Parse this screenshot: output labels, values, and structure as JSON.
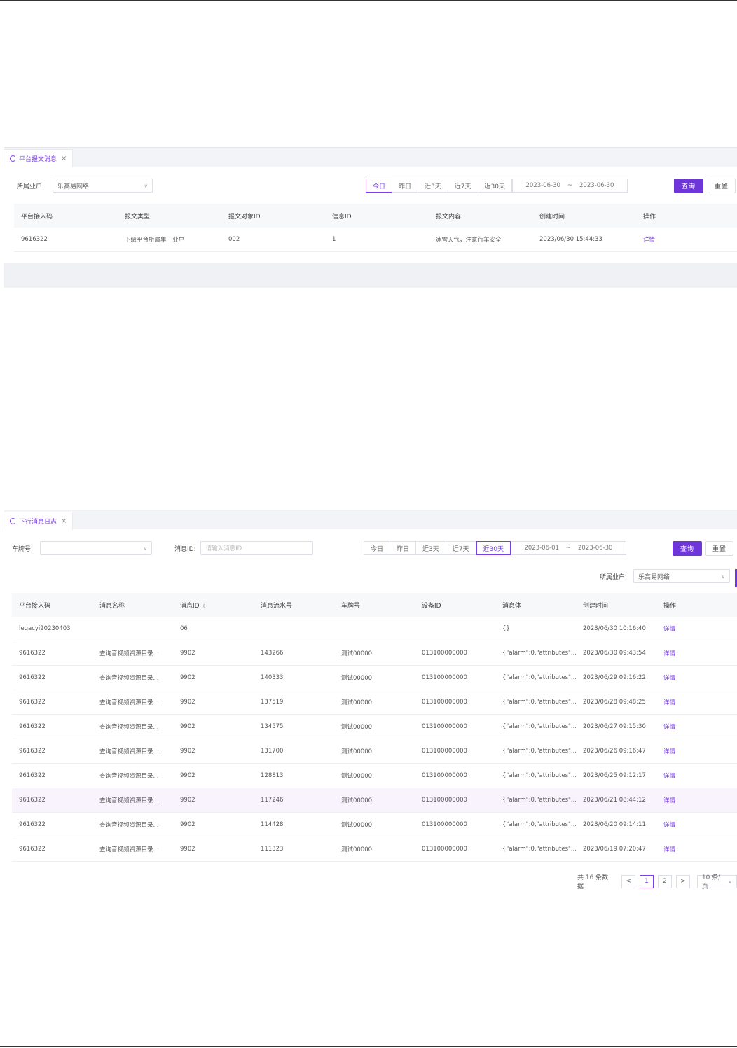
{
  "panel1": {
    "tab_label": "平台报文消息",
    "filter_label": "所属业户:",
    "filter_value": "乐高易网络",
    "quick_ranges": [
      "今日",
      "昨日",
      "近3天",
      "近7天",
      "近30天"
    ],
    "active_range": 0,
    "date_start": "2023-06-30",
    "date_sep": "~",
    "date_end": "2023-06-30",
    "query_label": "查询",
    "reset_label": "重置",
    "columns": [
      "平台接入码",
      "报文类型",
      "报文对象ID",
      "信息ID",
      "报文内容",
      "创建时间",
      "操作"
    ],
    "rows": [
      [
        "9616322",
        "下级平台所属单一业户",
        "002",
        "1",
        "冰雪天气，注意行车安全",
        "2023/06/30 15:44:33",
        "详情"
      ]
    ]
  },
  "panel2": {
    "tab_label": "下行消息日志",
    "plate_label": "车牌号:",
    "plate_value": "",
    "msgid_label": "消息ID:",
    "msgid_placeholder": "请输入消息ID",
    "quick_ranges": [
      "今日",
      "昨日",
      "近3天",
      "近7天",
      "近30天"
    ],
    "active_range": 4,
    "date_start": "2023-06-01",
    "date_sep": "~",
    "date_end": "2023-06-30",
    "query_label": "查询",
    "reset_label": "重置",
    "tenant_label": "所属业户:",
    "tenant_value": "乐高易网络",
    "columns": [
      "平台接入码",
      "消息名称",
      "消息ID",
      "消息流水号",
      "车牌号",
      "设备ID",
      "消息体",
      "创建时间",
      "操作"
    ],
    "sort_icon": "⇕",
    "rows": [
      [
        "legacyi20230403",
        "",
        "06",
        "",
        "",
        "",
        "{}",
        "2023/06/30 10:16:40",
        "详情"
      ],
      [
        "9616322",
        "查询音视频资源目录...",
        "9902",
        "143266",
        "测试00000",
        "013100000000",
        "{\"alarm\":0,\"attributes\"...",
        "2023/06/30 09:43:54",
        "详情"
      ],
      [
        "9616322",
        "查询音视频资源目录...",
        "9902",
        "140333",
        "测试00000",
        "013100000000",
        "{\"alarm\":0,\"attributes\"...",
        "2023/06/29 09:16:22",
        "详情"
      ],
      [
        "9616322",
        "查询音视频资源目录...",
        "9902",
        "137519",
        "测试00000",
        "013100000000",
        "{\"alarm\":0,\"attributes\"...",
        "2023/06/28 09:48:25",
        "详情"
      ],
      [
        "9616322",
        "查询音视频资源目录...",
        "9902",
        "134575",
        "测试00000",
        "013100000000",
        "{\"alarm\":0,\"attributes\"...",
        "2023/06/27 09:15:30",
        "详情"
      ],
      [
        "9616322",
        "查询音视频资源目录...",
        "9902",
        "131700",
        "测试00000",
        "013100000000",
        "{\"alarm\":0,\"attributes\"...",
        "2023/06/26 09:16:47",
        "详情"
      ],
      [
        "9616322",
        "查询音视频资源目录...",
        "9902",
        "128813",
        "测试00000",
        "013100000000",
        "{\"alarm\":0,\"attributes\"...",
        "2023/06/25 09:12:17",
        "详情"
      ],
      [
        "9616322",
        "查询音视频资源目录...",
        "9902",
        "117246",
        "测试00000",
        "013100000000",
        "{\"alarm\":0,\"attributes\"...",
        "2023/06/21 08:44:12",
        "详情"
      ],
      [
        "9616322",
        "查询音视频资源目录...",
        "9902",
        "114428",
        "测试00000",
        "013100000000",
        "{\"alarm\":0,\"attributes\"...",
        "2023/06/20 09:14:11",
        "详情"
      ],
      [
        "9616322",
        "查询音视频资源目录...",
        "9902",
        "111323",
        "测试00000",
        "013100000000",
        "{\"alarm\":0,\"attributes\"...",
        "2023/06/19 07:20:47",
        "详情"
      ]
    ],
    "highlight_row": 7,
    "pagination": {
      "total_text": "共 16 条数据",
      "prev": "<",
      "next": ">",
      "pages": [
        "1",
        "2"
      ],
      "active_page": 0,
      "page_size": "10 条/页"
    }
  },
  "colors": {
    "accent": "#6e36d8",
    "link": "#7b3fe4",
    "header_bg": "#f7f8fa"
  }
}
